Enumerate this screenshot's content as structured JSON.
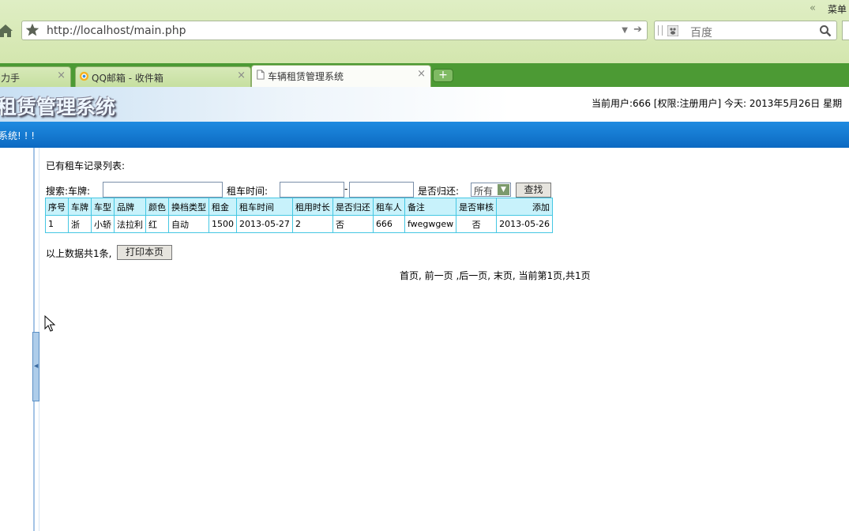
{
  "browser": {
    "menu_arrows": "«",
    "menu_label": "菜单",
    "url": "http://localhost/main.php",
    "search_placeholder": "百度",
    "tabs": [
      {
        "label": "力手"
      },
      {
        "label": "QQ邮箱 - 收件箱"
      },
      {
        "label": "车辆租赁管理系统"
      }
    ],
    "new_tab_label": "+",
    "close_glyph": "×",
    "icons": {
      "home": "home-icon",
      "bookmark": "star-icon",
      "dropdown": "chevron-down-icon",
      "go": "arrow-right-icon",
      "search": "magnifier-icon"
    }
  },
  "page": {
    "site_title": "租赁管理系统",
    "user_info": "当前用户:666 [权限:注册用户] 今天: 2013年5月26日 星期",
    "nav_text": "系统! ! !",
    "list_title": "已有租车记录列表:",
    "search": {
      "plate_label": "搜索:车牌:",
      "time_label": "租车时间:",
      "range_sep": "-",
      "returned_label": "是否归还:",
      "returned_value": "所有",
      "find_label": "查找"
    },
    "table": {
      "headers": [
        "序号",
        "车牌",
        "车型",
        "品牌",
        "颜色",
        "换档类型",
        "租金",
        "租车时间",
        "租用时长",
        "是否归还",
        "租车人",
        "备注",
        "是否审核",
        "添加"
      ],
      "rows": [
        [
          "1",
          "浙",
          "小轿",
          "法拉利",
          "红",
          "自动",
          "1500",
          "2013-05-27",
          "2",
          "否",
          "666",
          "fwegwgew",
          "否",
          "2013-05-26"
        ]
      ]
    },
    "summary": "以上数据共1条,",
    "print_label": "打印本页",
    "pager": "首页, 前一页 ,后一页, 末页, 当前第1页,共1页"
  },
  "colors": {
    "nav_blue": "#1279d2",
    "table_border": "#45c7e3",
    "table_header": "#c8f2fb",
    "tab_strip": "#4c9a34"
  }
}
